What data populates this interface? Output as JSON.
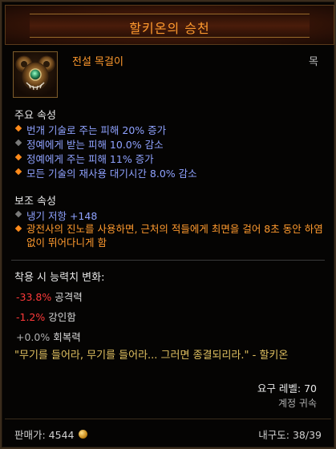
{
  "title": "할키온의 승천",
  "item": {
    "type": "전설 목걸이",
    "slot": "목",
    "icon": "amulet-icon"
  },
  "primary": {
    "header": "주요 속성",
    "stats": [
      {
        "text": "번개 기술로 주는 피해 20% 증가",
        "bullet": "orange"
      },
      {
        "text": "정예에게 받는 피해 10.0% 감소",
        "bullet": "grey"
      },
      {
        "text": "정예에게 주는 피해 11% 증가",
        "bullet": "orange"
      },
      {
        "text": "모든 기술의 재사용 대기시간 8.0% 감소",
        "bullet": "orange"
      }
    ]
  },
  "secondary": {
    "header": "보조 속성",
    "stats": [
      {
        "text": "냉기 저항 +148",
        "bullet": "grey"
      },
      {
        "text": "광전사의 진노를 사용하면, 근처의 적들에게 최면을 걸어 8초 동안 하염없이 뛰어다니게 함",
        "bullet": "orange"
      }
    ]
  },
  "changes": {
    "header": "착용 시 능력치 변화:",
    "rows": [
      {
        "value": "-33.8%",
        "label": "공격력",
        "tone": "red"
      },
      {
        "value": "-1.2%",
        "label": "강인함",
        "tone": "red"
      },
      {
        "value": "+0.0%",
        "label": "회복력",
        "tone": "neutral"
      }
    ]
  },
  "quote": "\"무기를 들어라, 무기를 들어라... 그러면 종결되리라.\" - 할키온",
  "requirement": "요구 레벨: 70",
  "binding": "계정 귀속",
  "footer": {
    "price_label": "판매가: 4544",
    "durability": "내구도: 38/39"
  },
  "colors": {
    "legendary": "#ff9a2e",
    "magic": "#8fa2ff",
    "negative": "#ff3a3a",
    "quote": "#e0c060"
  }
}
